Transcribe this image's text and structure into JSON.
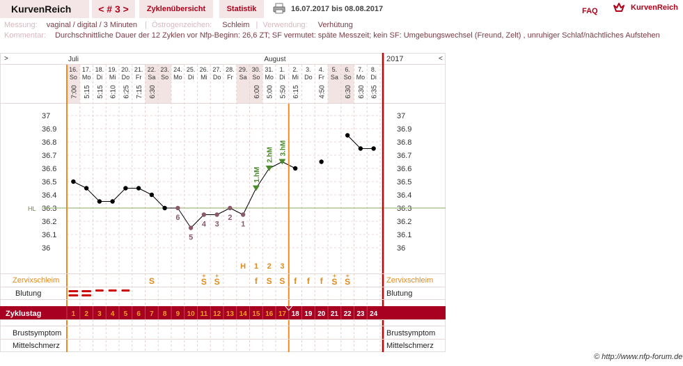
{
  "topbar": {
    "brand": "KurvenReich",
    "cycle": "< # 3 >",
    "tabs": [
      "Zyklenübersicht",
      "Statistik"
    ],
    "date_range": "16.07.2017 bis 08.08.2017",
    "faq": "FAQ",
    "logo_text": "KurvenReich",
    "printer_icon": "printer-icon",
    "logo_icon": "crown-icon"
  },
  "info": {
    "messung_label": "Messung:",
    "messung_value": "vaginal / digital / 3 Minuten",
    "oestrogen_label": "Östrogenzeichen:",
    "oestrogen_value": "Schleim",
    "verwendung_label": "Verwendung:",
    "verwendung_value": "Verhütung",
    "kommentar_label": "Kommentar:",
    "kommentar_value": "Durchschnittliche Dauer der 12 Zyklen vor Nfp-Beginn: 26,6 ZT;   SF vermutet: späte Messzeit; kein SF: Umgebungswechsel (Freund, Zelt) , unruhiger Schlaf/nächtliches Aufstehen"
  },
  "chart_data": {
    "type": "line",
    "nav_left": ">",
    "nav_right": "<",
    "year": "2017",
    "months": [
      "Juli",
      "August"
    ],
    "days": [
      "16.",
      "17.",
      "18.",
      "19.",
      "20.",
      "21.",
      "22.",
      "23.",
      "24.",
      "25.",
      "26.",
      "27.",
      "28.",
      "29.",
      "30.",
      "31.",
      "1.",
      "2.",
      "3.",
      "4.",
      "5.",
      "6.",
      "7.",
      "8."
    ],
    "weekdays": [
      "So",
      "Mo",
      "Di",
      "Mi",
      "Do",
      "Fr",
      "Sa",
      "So",
      "Mo",
      "Di",
      "Mi",
      "Do",
      "Fr",
      "Sa",
      "So",
      "Mo",
      "Di",
      "Mi",
      "Do",
      "Fr",
      "Sa",
      "So",
      "Mo",
      "Di"
    ],
    "times": [
      "7:00",
      "5:15",
      "5:15",
      "6:10",
      "6:25",
      "7:15",
      "6:30",
      "",
      "",
      "",
      "",
      "",
      "",
      "",
      "6:00",
      "5:00",
      "5:50",
      "6:15",
      "",
      "4:50",
      "",
      "6:30",
      "6:30",
      "6:35"
    ],
    "weekend": [
      true,
      false,
      false,
      false,
      false,
      false,
      true,
      true,
      false,
      false,
      false,
      false,
      false,
      true,
      true,
      false,
      false,
      false,
      false,
      false,
      true,
      true,
      false,
      false
    ],
    "temperatures": [
      36.5,
      36.45,
      36.35,
      36.35,
      36.45,
      36.45,
      36.4,
      36.3,
      36.3,
      36.15,
      36.25,
      36.25,
      36.3,
      36.25,
      36.45,
      36.6,
      36.65,
      36.6,
      null,
      36.65,
      null,
      36.85,
      36.75,
      36.75
    ],
    "excluded": [
      false,
      false,
      false,
      false,
      false,
      false,
      false,
      false,
      true,
      true,
      true,
      true,
      true,
      true,
      false,
      false,
      false,
      false,
      false,
      false,
      false,
      false,
      false,
      false
    ],
    "connected": [
      true,
      true,
      true,
      true,
      true,
      true,
      true,
      true,
      true,
      true,
      true,
      true,
      true,
      true,
      true,
      true,
      true,
      true,
      false,
      false,
      false,
      true,
      true,
      true
    ],
    "low_numbers": [
      {
        "day": 9,
        "label": "6"
      },
      {
        "day": 10,
        "label": "5"
      },
      {
        "day": 11,
        "label": "4"
      },
      {
        "day": 12,
        "label": "3"
      },
      {
        "day": 13,
        "label": "2"
      },
      {
        "day": 14,
        "label": "1"
      }
    ],
    "high_markers": [
      {
        "day": 15,
        "label": "1.hM"
      },
      {
        "day": 16,
        "label": "2.hM"
      },
      {
        "day": 17,
        "label": "3.hM"
      }
    ],
    "y_ticks": [
      37,
      36.9,
      36.8,
      36.7,
      36.6,
      36.5,
      36.4,
      36.3,
      36.2,
      36.1,
      36
    ],
    "y_tick_labels": [
      "37",
      "36.9",
      "36.8",
      "36.7",
      "36.6",
      "36.5",
      "36.4",
      "36.3",
      "36.2",
      "36.1",
      "36"
    ],
    "ylim": [
      35.95,
      37.05
    ],
    "hl_label": "HL",
    "hl_value": 36.3,
    "counting_labels": [
      "H",
      "1",
      "2",
      "3"
    ],
    "counting_days": [
      14,
      15,
      16,
      17
    ],
    "zervix_label": "Zervixschleim",
    "zervix": [
      "",
      "",
      "",
      "",
      "",
      "",
      "S",
      "",
      "",
      "",
      "S+",
      "S+",
      "",
      "",
      "f",
      "S",
      "S",
      "f",
      "f",
      "f",
      "S+",
      "S+",
      "",
      ""
    ],
    "blutung_label": "Blutung",
    "blutung": [
      "heavy",
      "medium",
      "light",
      "light",
      "light",
      "",
      "",
      "",
      "",
      "",
      "",
      "",
      "",
      "",
      "",
      "",
      "",
      "",
      "",
      "",
      "",
      "",
      "",
      ""
    ],
    "zyklustag_label": "Zyklustag",
    "zyklustage": [
      "1",
      "2",
      "3",
      "4",
      "5",
      "6",
      "7",
      "8",
      "9",
      "10",
      "11",
      "12",
      "13",
      "14",
      "15",
      "16",
      "17",
      "18",
      "19",
      "20",
      "21",
      "22",
      "23",
      "24"
    ],
    "brustsymptom_label": "Brustsymptom",
    "mittelschmerz_label": "Mittelschmerz",
    "colors": {
      "temperature": "#000000",
      "excluded_point": "#8b5a6a",
      "high_marker": "#4a8a2a",
      "hl_line": "#8aaa60",
      "zervix": "#e08a1a",
      "blutung": "#cc0000",
      "zyklustag_bar": "#a80020",
      "zyklustag_inner": "#f0a020",
      "ovulation_line": "#f08a20",
      "cycle_end_line": "#cc0000"
    }
  },
  "copyright": "© http://www.nfp-forum.de"
}
